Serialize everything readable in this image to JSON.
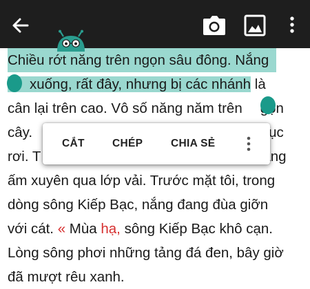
{
  "toolbar": {
    "back_icon": "arrow-back-icon",
    "camera_icon": "camera-icon",
    "image_icon": "image-icon",
    "more_icon": "more-vert-icon"
  },
  "text": {
    "line1": "Chiều rớt năng trên ngọn sâu đông. Nắng",
    "line2_sel": "xuống, rất đây, nhưng bị các nhánh",
    "line2_rest": " là",
    "line3_a": "cân lại trên cao. Vô số năng năm trên",
    "line3_b": "gọn",
    "line4_a": "cây.",
    "line4_b": "ục",
    "line5_a": "rơi. T",
    "line5_b": "ăng",
    "line6": "ấm xuyên qua lớp vải. Trước mặt tôi, trong",
    "line7": "dòng sông Kiếp Bạc, nắng đang đùa giỡn",
    "line8_a": "với cát. ",
    "line8_quote": "«",
    "line8_b": " Mùa ",
    "line8_red": "hạ,",
    "line8_c": " sông Kiếp Bạc khô cạn.",
    "line9": "Lòng sông phơi những tảng đá đen, bây giờ",
    "line10": "đã mượt rêu xanh."
  },
  "menu": {
    "cut": "CẮT",
    "copy": "CHÉP",
    "share": "CHIA SẺ",
    "more_icon": "more-vert-icon"
  },
  "colors": {
    "toolbar_bg": "#1e1e1e",
    "selection": "#9ad8cf",
    "handle": "#1a9a8a",
    "accent_red": "#d62f2f"
  }
}
